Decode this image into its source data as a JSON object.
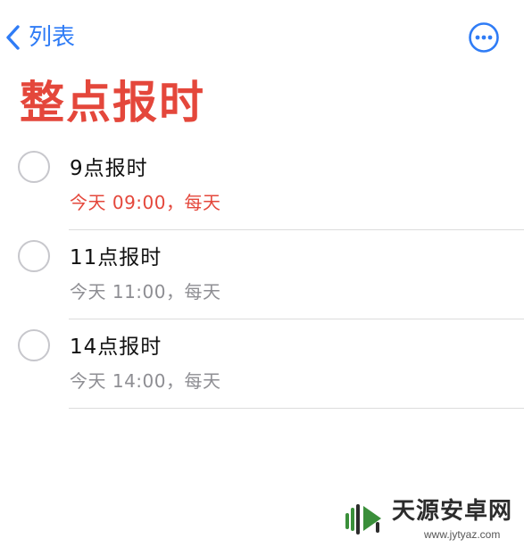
{
  "nav": {
    "back_label": "列表",
    "accent_color": "#2f7cf6",
    "back_icon": "chevron-left-icon",
    "more_icon": "ellipsis-circle-icon"
  },
  "page": {
    "title": "整点报时",
    "title_color": "#e4473b"
  },
  "reminders": [
    {
      "title": "9点报时",
      "subtitle": "今天 09:00，每天",
      "overdue": true,
      "completed": false
    },
    {
      "title": "11点报时",
      "subtitle": "今天 11:00，每天",
      "overdue": false,
      "completed": false
    },
    {
      "title": "14点报时",
      "subtitle": "今天 14:00，每天",
      "overdue": false,
      "completed": false
    }
  ],
  "watermark": {
    "text": "天源安卓网",
    "url": "www.jytyaz.com"
  }
}
